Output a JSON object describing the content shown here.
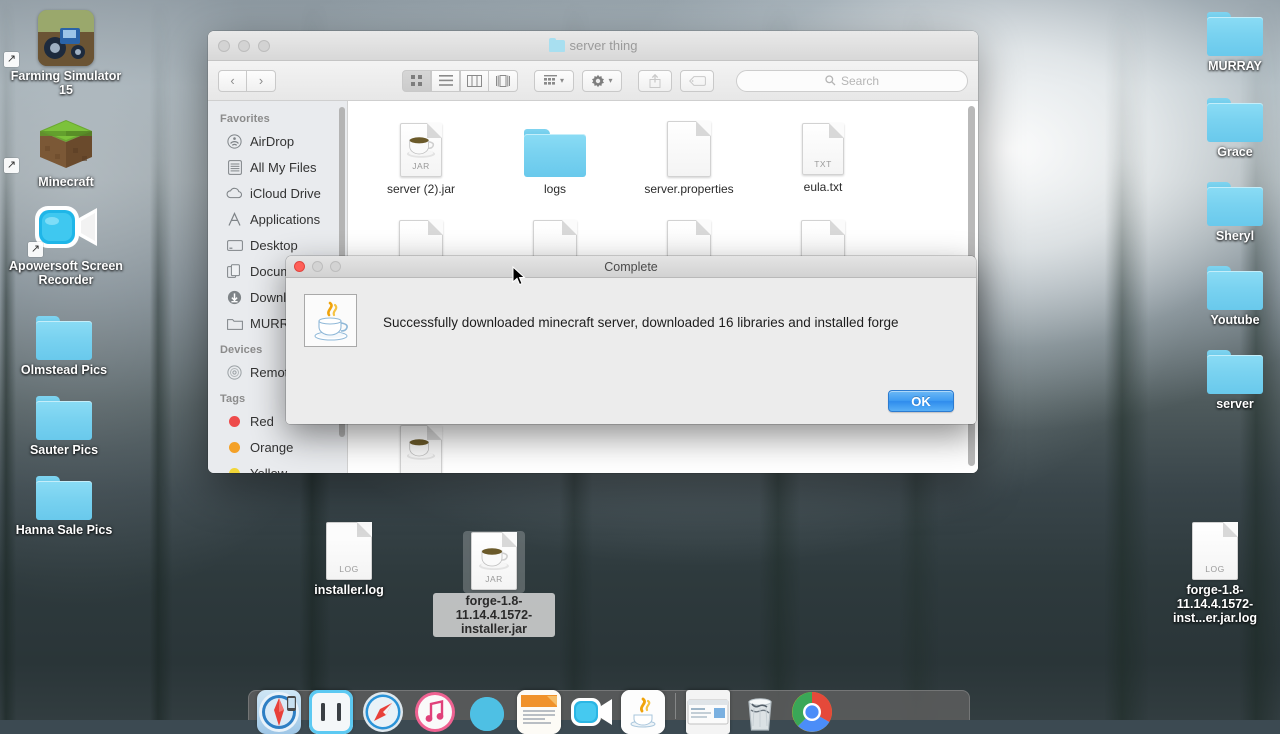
{
  "desktop": {
    "icons_left": [
      {
        "name": "Farming Simulator 15",
        "type": "app-alias",
        "icon": "tractor-game-icon"
      },
      {
        "name": "Minecraft",
        "type": "app-alias",
        "icon": "grass-block-icon"
      },
      {
        "name": "Apowersoft Screen Recorder",
        "type": "app-alias",
        "icon": "screen-recorder-icon"
      },
      {
        "name": "Olmstead Pics",
        "type": "folder",
        "icon": "folder-icon"
      },
      {
        "name": "Sauter Pics",
        "type": "folder",
        "icon": "folder-icon"
      },
      {
        "name": "Hanna Sale Pics",
        "type": "folder",
        "icon": "folder-icon"
      }
    ],
    "icons_right": [
      {
        "name": "MURRAY",
        "type": "folder",
        "icon": "folder-icon"
      },
      {
        "name": "Grace",
        "type": "folder",
        "icon": "folder-icon"
      },
      {
        "name": "Sheryl",
        "type": "folder",
        "icon": "folder-icon"
      },
      {
        "name": "Youtube",
        "type": "folder",
        "icon": "folder-icon"
      },
      {
        "name": "server",
        "type": "folder",
        "icon": "folder-icon"
      }
    ],
    "icons_bottom": [
      {
        "name": "installer.log",
        "type": "file",
        "ext": "LOG",
        "selected": false
      },
      {
        "name": "forge-1.8-11.14.4.1572-installer.jar",
        "type": "file",
        "ext": "JAR",
        "selected": true
      },
      {
        "name": "forge-1.8-11.14.4.1572-inst...er.jar.log",
        "type": "file",
        "ext": "LOG",
        "selected": false
      }
    ]
  },
  "finder": {
    "title": "server thing",
    "toolbar": {
      "back_label": "‹",
      "forward_label": "›",
      "view_icon_label": "icon-view",
      "view_list_label": "list-view",
      "view_column_label": "column-view",
      "view_cover_label": "coverflow-view",
      "arrange_label": "arrange",
      "action_label": "action",
      "share_label": "share",
      "tag_label": "tag"
    },
    "search": {
      "placeholder": "Search"
    },
    "sidebar": {
      "sections": [
        {
          "header": "Favorites",
          "items": [
            {
              "label": "AirDrop",
              "icon": "airdrop-icon"
            },
            {
              "label": "All My Files",
              "icon": "all-my-files-icon"
            },
            {
              "label": "iCloud Drive",
              "icon": "icloud-icon"
            },
            {
              "label": "Applications",
              "icon": "applications-icon"
            },
            {
              "label": "Desktop",
              "icon": "desktop-icon"
            },
            {
              "label": "Documents",
              "icon": "documents-icon"
            },
            {
              "label": "Downloads",
              "icon": "downloads-icon"
            },
            {
              "label": "MURRAY",
              "icon": "folder-icon"
            }
          ]
        },
        {
          "header": "Devices",
          "items": [
            {
              "label": "Remote Disc",
              "icon": "remote-disc-icon"
            }
          ]
        },
        {
          "header": "Tags",
          "items": [
            {
              "label": "Red",
              "icon": "tag-dot",
              "color": "#ee4b4b"
            },
            {
              "label": "Orange",
              "icon": "tag-dot",
              "color": "#f4a128"
            },
            {
              "label": "Yellow",
              "icon": "tag-dot",
              "color": "#f2d638"
            }
          ]
        }
      ]
    },
    "files": {
      "row1": [
        {
          "name": "server (2).jar",
          "type": "jar",
          "ext": "JAR"
        },
        {
          "name": "logs",
          "type": "folder",
          "ext": ""
        },
        {
          "name": "server.properties",
          "type": "doc",
          "ext": ""
        },
        {
          "name": "eula.txt",
          "type": "doc",
          "ext": "TXT"
        }
      ],
      "row2": [
        {
          "name": "",
          "type": "doc",
          "ext": ""
        },
        {
          "name": "",
          "type": "doc",
          "ext": ""
        },
        {
          "name": "",
          "type": "doc",
          "ext": ""
        },
        {
          "name": "",
          "type": "doc",
          "ext": ""
        }
      ],
      "row3": [
        {
          "name": "",
          "type": "jar",
          "ext": ""
        }
      ]
    }
  },
  "dialog": {
    "title": "Complete",
    "message": "Successfully downloaded minecraft server, downloaded 16 libraries and installed forge",
    "ok_label": "OK",
    "icon": "java-coffee-cup-icon"
  },
  "dock": {
    "items": [
      {
        "name": "Finder",
        "icon": "finder-icon"
      },
      {
        "name": "Launchpad",
        "icon": "launchpad-icon"
      },
      {
        "name": "Google Chrome",
        "icon": "chrome-icon"
      },
      {
        "name": "Safari",
        "icon": "safari-icon"
      },
      {
        "name": "iTunes",
        "icon": "itunes-icon"
      },
      {
        "name": "Photos",
        "icon": "photos-icon"
      },
      {
        "name": "Pages",
        "icon": "pages-icon"
      },
      {
        "name": "Apowersoft Screen Recorder",
        "icon": "screen-recorder-icon"
      },
      {
        "name": "Java",
        "icon": "java-icon"
      }
    ],
    "right_items": [
      {
        "name": "Downloads Stack",
        "icon": "downloads-stack-icon"
      },
      {
        "name": "Trash",
        "icon": "trash-icon"
      }
    ]
  },
  "colors": {
    "accent_blue": "#3f9cf2",
    "folder_blue": "#79d2f0",
    "close_red": "#ff5f57"
  }
}
